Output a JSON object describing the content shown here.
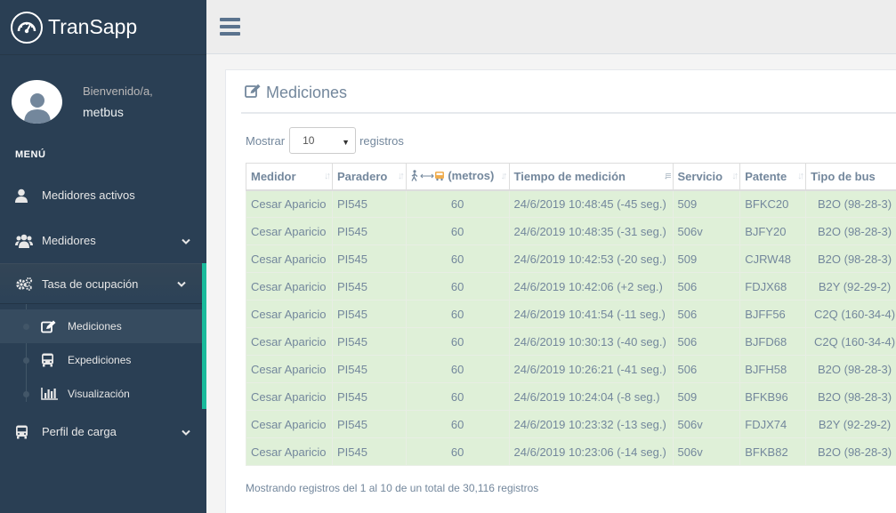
{
  "app": {
    "title": "TranSapp"
  },
  "profile": {
    "welcome": "Bienvenido/a,",
    "username": "metbus"
  },
  "menu": {
    "title": "MENÚ",
    "items": [
      {
        "label": "Medidores activos",
        "icon": "user-icon"
      },
      {
        "label": "Medidores",
        "icon": "users-icon"
      },
      {
        "label": "Tasa de ocupación",
        "icon": "gears-icon"
      },
      {
        "label": "Perfil de carga",
        "icon": "bus-icon"
      }
    ],
    "subitems": [
      {
        "label": "Mediciones",
        "icon": "edit-icon"
      },
      {
        "label": "Expediciones",
        "icon": "bus-icon"
      },
      {
        "label": "Visualización",
        "icon": "bar-chart-icon"
      }
    ]
  },
  "panel": {
    "title": "Mediciones",
    "length_prefix": "Mostrar",
    "length_value": "10",
    "length_suffix": "registros",
    "footer": "Mostrando registros del 1 al 10 de un total de 30,116 registros"
  },
  "table": {
    "headers": [
      "Medidor",
      "Paradero",
      "(metros)",
      "Tiempo de medición",
      "Servicio",
      "Patente",
      "Tipo de bus"
    ],
    "rows": [
      [
        "Cesar Aparicio",
        "PI545",
        "60",
        "24/6/2019 10:48:45 (-45 seg.)",
        "509",
        "BFKC20",
        "B2O (98-28-3)"
      ],
      [
        "Cesar Aparicio",
        "PI545",
        "60",
        "24/6/2019 10:48:35 (-31 seg.)",
        "506v",
        "BJFY20",
        "B2O (98-28-3)"
      ],
      [
        "Cesar Aparicio",
        "PI545",
        "60",
        "24/6/2019 10:42:53 (-20 seg.)",
        "509",
        "CJRW48",
        "B2O (98-28-3)"
      ],
      [
        "Cesar Aparicio",
        "PI545",
        "60",
        "24/6/2019 10:42:06 (+2 seg.)",
        "506",
        "FDJX68",
        "B2Y (92-29-2)"
      ],
      [
        "Cesar Aparicio",
        "PI545",
        "60",
        "24/6/2019 10:41:54 (-11 seg.)",
        "506",
        "BJFF56",
        "C2Q (160-34-4)"
      ],
      [
        "Cesar Aparicio",
        "PI545",
        "60",
        "24/6/2019 10:30:13 (-40 seg.)",
        "506",
        "BJFD68",
        "C2Q (160-34-4)"
      ],
      [
        "Cesar Aparicio",
        "PI545",
        "60",
        "24/6/2019 10:26:21 (-41 seg.)",
        "506",
        "BJFH58",
        "B2O (98-28-3)"
      ],
      [
        "Cesar Aparicio",
        "PI545",
        "60",
        "24/6/2019 10:24:04 (-8 seg.)",
        "509",
        "BFKB96",
        "B2O (98-28-3)"
      ],
      [
        "Cesar Aparicio",
        "PI545",
        "60",
        "24/6/2019 10:23:32 (-13 seg.)",
        "506v",
        "FDJX74",
        "B2Y (92-29-2)"
      ],
      [
        "Cesar Aparicio",
        "PI545",
        "60",
        "24/6/2019 10:23:06 (-14 seg.)",
        "506v",
        "BFKB82",
        "B2O (98-28-3)"
      ]
    ]
  },
  "colors": {
    "sidebar": "#2a3f54",
    "accent": "#1abb9c",
    "row_success": "#dff0d8",
    "text": "#73879c"
  }
}
